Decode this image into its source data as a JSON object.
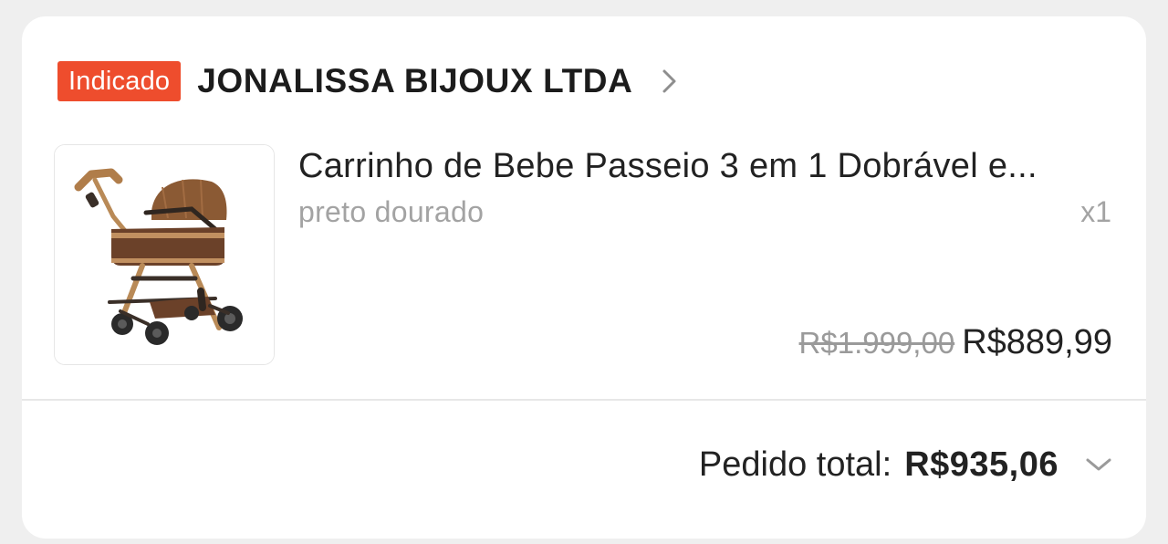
{
  "shop": {
    "badge": "Indicado",
    "name": "JONALISSA BIJOUX LTDA",
    "chevron_icon": "chevron-right-icon"
  },
  "product": {
    "image_icon": "baby-stroller-image",
    "title": "Carrinho de Bebe Passeio 3 em 1 Dobrável e...",
    "variation": "preto dourado",
    "quantity": "x1",
    "original_price": "R$1.999,00",
    "price": "R$889,99"
  },
  "order": {
    "total_label": "Pedido total:",
    "total_value": "R$935,06",
    "expand_icon": "chevron-down-icon"
  },
  "colors": {
    "badge_bg": "#ee4d2d",
    "badge_text": "#ffffff",
    "card_bg": "#ffffff",
    "page_bg": "#efefef",
    "primary_text": "#222222",
    "muted_text": "#a3a3a3"
  }
}
